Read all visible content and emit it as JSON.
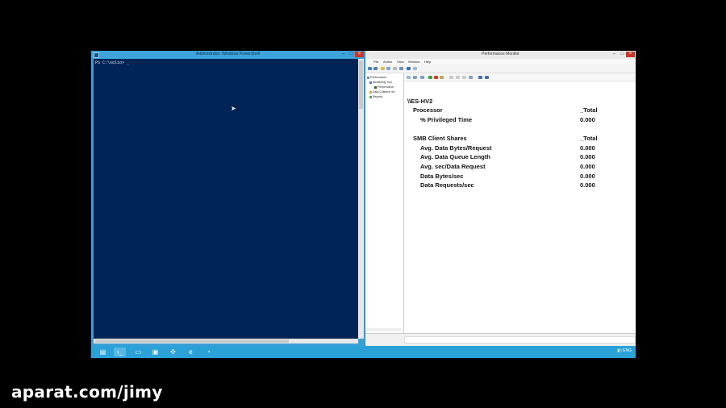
{
  "powershell": {
    "title": "Administrator: Windows PowerShell",
    "prompt": "PS C:\\sqlio> _"
  },
  "perfmon": {
    "title": "Performance Monitor",
    "menu": [
      "File",
      "Action",
      "View",
      "Window",
      "Help"
    ],
    "tree": [
      {
        "label": "Performance",
        "level": 0
      },
      {
        "label": "Monitoring Tool",
        "level": 1
      },
      {
        "label": "Performance",
        "level": 2
      },
      {
        "label": "Data Collector Se",
        "level": 1
      },
      {
        "label": "Reports",
        "level": 1
      }
    ],
    "report": {
      "machine": "\\\\ES-HV2",
      "groups": [
        {
          "object": "Processor",
          "instance": "_Total",
          "counters": [
            {
              "name": "% Privileged Time",
              "value": "0.000"
            }
          ]
        },
        {
          "object": "SMB Client Shares",
          "instance": "_Total",
          "counters": [
            {
              "name": "Avg. Data Bytes/Request",
              "value": "0.000"
            },
            {
              "name": "Avg. Data Queue Length",
              "value": "0.000"
            },
            {
              "name": "Avg. sec/Data Request",
              "value": "0.000"
            },
            {
              "name": "Data Bytes/sec",
              "value": "0.000"
            },
            {
              "name": "Data Requests/sec",
              "value": "0.000"
            }
          ]
        }
      ]
    }
  },
  "taskbar": {
    "items": [
      {
        "name": "server-manager-icon",
        "glyph": "▤"
      },
      {
        "name": "powershell-icon",
        "glyph": "›_",
        "active": true
      },
      {
        "name": "file-explorer-icon",
        "glyph": "▭"
      },
      {
        "name": "hyper-v-manager-icon",
        "glyph": "▣"
      },
      {
        "name": "network-icon",
        "glyph": "✣"
      },
      {
        "name": "internet-explorer-icon",
        "glyph": "e"
      },
      {
        "name": "performance-monitor-icon",
        "glyph": "◔"
      }
    ],
    "tray": "▮▯ ENG"
  },
  "watermark": "aparat.com/jimy",
  "colors": {
    "console_bg": "#012456",
    "desktop": "#1a8fc4",
    "taskbar": "#2aa2d8"
  }
}
